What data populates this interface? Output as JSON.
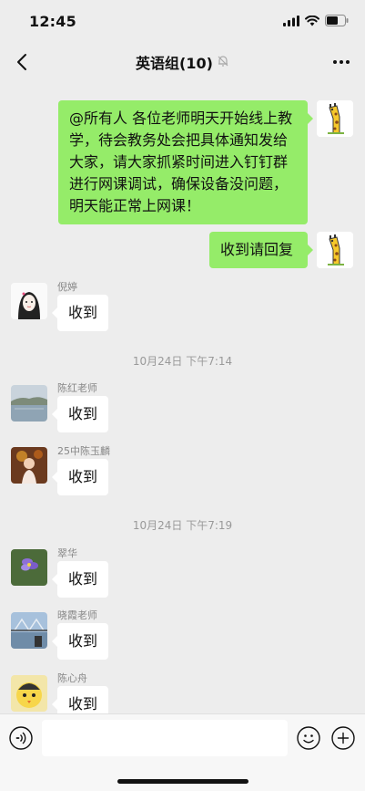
{
  "status_bar": {
    "time": "12:45"
  },
  "header": {
    "title": "英语组(10)"
  },
  "messages": [
    {
      "text": "@所有人 各位老师明天开始线上教学，待会教务处会把具体通知发给大家，请大家抓紧时间进入钉钉群进行网课调试，确保设备没问题，明天能正常上网课！"
    },
    {
      "text": "收到请回复"
    },
    {
      "sender": "倪婷",
      "text": "收到"
    },
    {
      "timestamp": "10月24日 下午7:14"
    },
    {
      "sender": "陈红老师",
      "text": "收到"
    },
    {
      "sender": "25中陈玉麟",
      "text": "收到"
    },
    {
      "timestamp": "10月24日 下午7:19"
    },
    {
      "sender": "翠华",
      "text": "收到"
    },
    {
      "sender": "晓霞老师",
      "text": "收到"
    },
    {
      "sender": "陈心舟",
      "text": "收到"
    }
  ],
  "input": {
    "value": ""
  },
  "colors": {
    "background": "#ededed",
    "outgoing_bubble": "#95ec69",
    "incoming_bubble": "#ffffff"
  }
}
